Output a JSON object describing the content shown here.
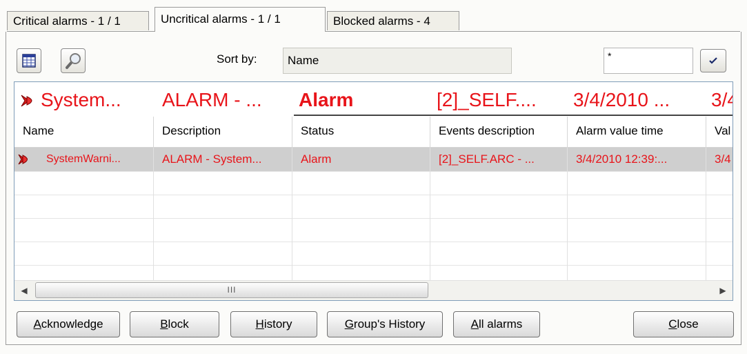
{
  "tabs": [
    {
      "label": "Critical alarms - 1 / 1",
      "active": false
    },
    {
      "label": "Uncritical alarms - 1 / 1",
      "active": true
    },
    {
      "label": "Blocked alarms - 4",
      "active": false
    }
  ],
  "toolbar": {
    "sort_label": "Sort by:",
    "sort_value": "Name",
    "filter_value": "*"
  },
  "group": [
    "System...",
    "ALARM - ...",
    "Alarm",
    "[2]_SELF....",
    "3/4/2010 ...",
    "3/4"
  ],
  "columns": [
    "Name",
    "Description",
    "Status",
    "Events description",
    "Alarm value time",
    "Val"
  ],
  "rows": [
    [
      "SystemWarni...",
      "ALARM - System...",
      "Alarm",
      "[2]_SELF.ARC - ...",
      "3/4/2010 12:39:...",
      "3/4"
    ]
  ],
  "scrollbar": {
    "grip": "III"
  },
  "buttons": {
    "acknowledge": {
      "first": "A",
      "rest": "cknowledge"
    },
    "block": {
      "first": "B",
      "rest": "lock"
    },
    "history": {
      "first": "H",
      "rest": "istory"
    },
    "group_history": {
      "first": "G",
      "rest": "roup's History"
    },
    "all_alarms": {
      "first": "A",
      "rest": "ll alarms"
    },
    "close": {
      "first": "C",
      "rest": "lose"
    }
  },
  "colors": {
    "alarm_text": "#e8141a",
    "selected_row": "#cfcfcf",
    "grid_border": "#7f9db9"
  },
  "icons": [
    "table-view-icon",
    "search-icon",
    "checkmark-icon",
    "alarm-bell-icon"
  ]
}
